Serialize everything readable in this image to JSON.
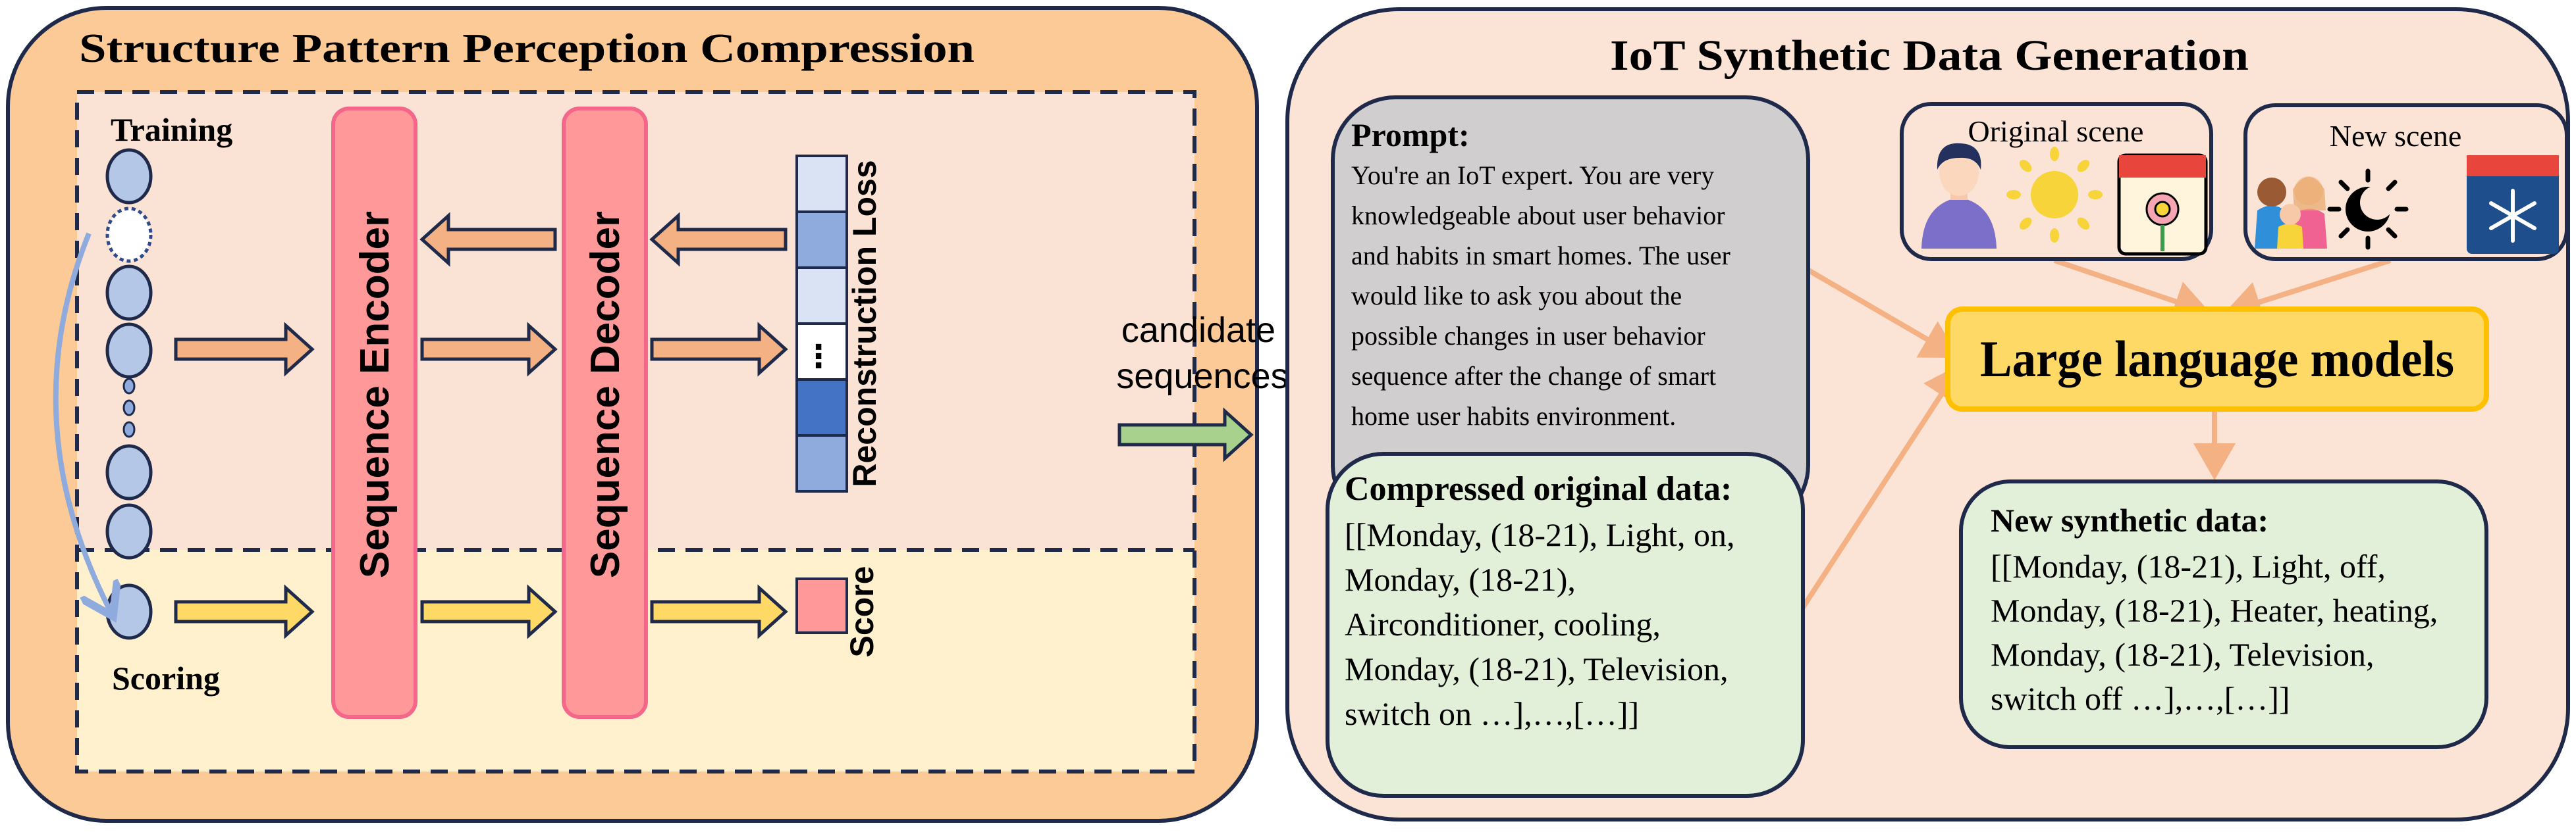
{
  "left_panel": {
    "title": "Structure Pattern Perception  Compression",
    "training_label": "Training",
    "scoring_label": "Scoring",
    "encoder_label": "Sequence  Encoder",
    "decoder_label": "Sequence  Decoder",
    "reconstruction_label": "Reconstruction Loss",
    "reconstruction_ellipsis": "⋮",
    "score_label": "Score"
  },
  "connector": {
    "line1": "candidate",
    "line2": "sequences"
  },
  "right_panel": {
    "title": "IoT Synthetic Data Generation",
    "prompt": {
      "heading": "Prompt:",
      "lines": [
        "You're an IoT expert. You are very",
        "knowledgeable about user behavior",
        "and habits in smart homes. The user",
        "would like to ask you about the",
        "possible changes in user behavior",
        "sequence after the change of smart",
        "home user habits environment."
      ]
    },
    "original_scene": {
      "label": "Original scene",
      "icons": [
        "man-icon",
        "sun-icon",
        "spring-calendar-icon"
      ]
    },
    "new_scene": {
      "label": "New scene",
      "icons": [
        "family-icon",
        "night-icon",
        "winter-calendar-icon"
      ]
    },
    "llm_label": "Large language models",
    "compressed": {
      "heading": "Compressed original data:",
      "lines": [
        "[[Monday, (18-21), Light, on,",
        "Monday, (18-21),",
        "Airconditioner, cooling,",
        "Monday, (18-21), Television,",
        "switch on …],…,[…]]"
      ]
    },
    "synthetic": {
      "heading": "New synthetic data:",
      "lines": [
        "[[Monday, (18-21), Light, off,",
        "Monday, (18-21), Heater, heating,",
        "Monday, (18-21), Television,",
        "switch off …],…,[…]]"
      ]
    }
  },
  "colors": {
    "left_bg": "#FBCA96",
    "right_bg": "#FBE4D6",
    "training_bg": "#FAE3D4",
    "scoring_bg": "#FFF1CE",
    "bar": "#FF9999",
    "bar_border": "#F4668A",
    "orange_arrow": "#F4B183",
    "yellow_arrow": "#FFD966",
    "green_arrow": "#A9D18E",
    "circle": "#B4C7E7",
    "prompt_bg": "#D0CECE",
    "data_bg": "#E2F0D9",
    "llm_bg": "#FFD966",
    "llm_border": "#FFC000",
    "outline": "#1F2A4A"
  }
}
